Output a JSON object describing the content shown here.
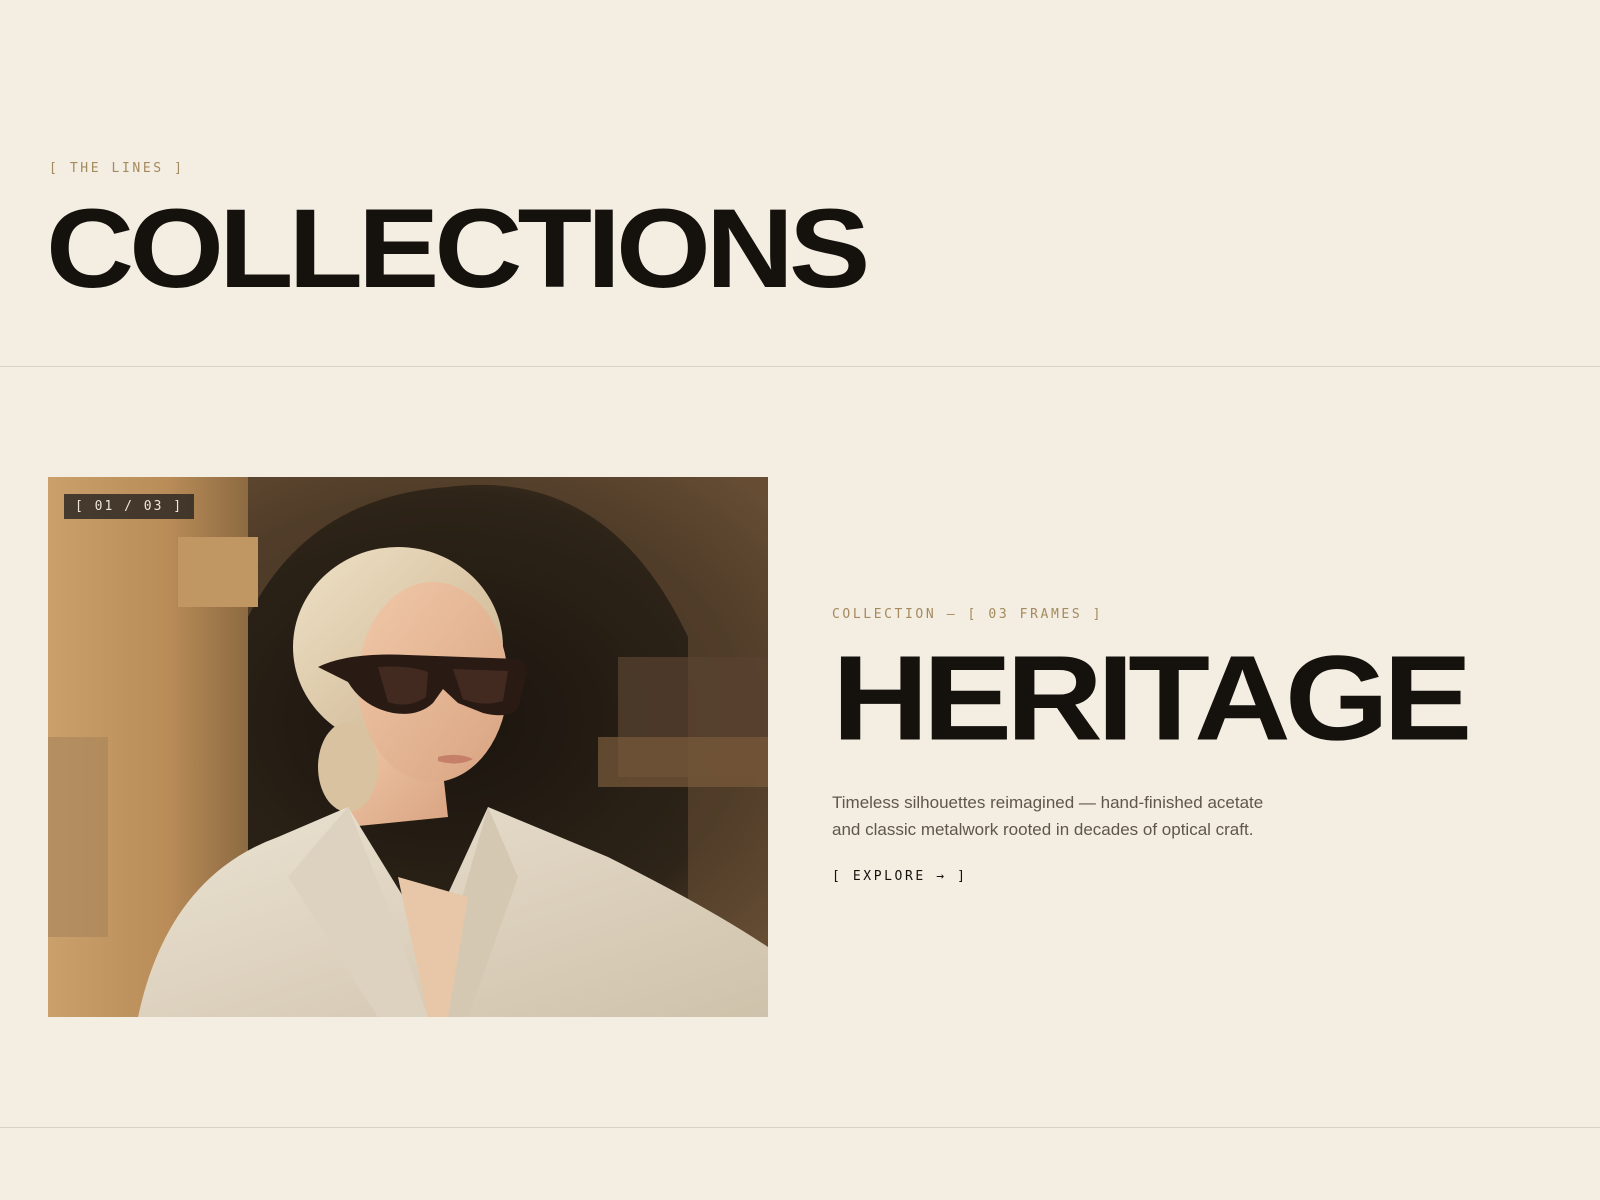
{
  "section": {
    "eyebrow": "[ THE LINES ]",
    "title": "COLLECTIONS"
  },
  "collection": {
    "counter": "[ 01 / 03 ]",
    "meta": "COLLECTION — [ 03 FRAMES ]",
    "name": "HERITAGE",
    "description": "Timeless silhouettes reimagined — hand-finished acetate and classic metalwork rooted in decades of optical craft.",
    "cta": "[ EXPLORE → ]"
  },
  "colors": {
    "background": "#f3ede2",
    "accent": "#a48a5e",
    "ink": "#15120e",
    "rule": "#d8d2c6"
  }
}
